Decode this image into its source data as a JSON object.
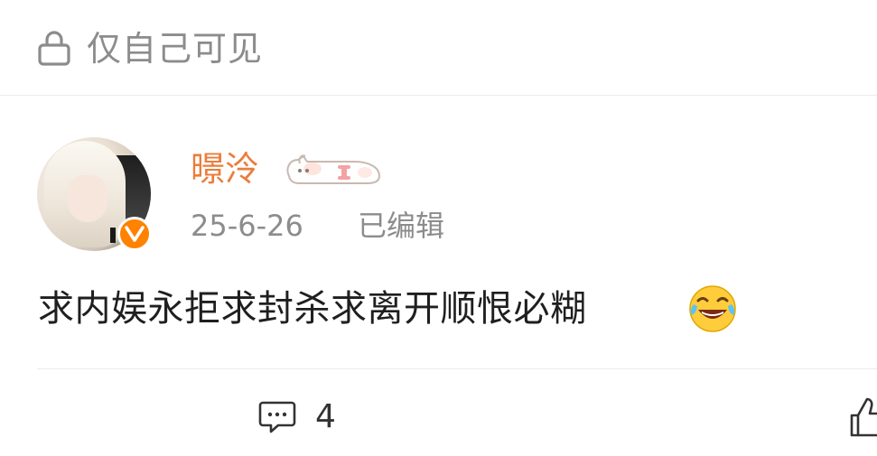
{
  "visibility": {
    "icon": "lock-icon",
    "label": "仅自己可见"
  },
  "comment": {
    "avatar": {
      "icon": "avatar",
      "verified_badge_letter": "V",
      "verified_color": "#ff8200"
    },
    "username": "暻泠",
    "username_color": "#eb7d3c",
    "badge_icon": "cat-fan-badge-icon",
    "timestamp": "25-6-26",
    "edited_label": "已编辑",
    "text": "求内娱永拒求封杀求离开顺恨必糊",
    "emoji": "laughing-tears-emoji"
  },
  "actions": {
    "comment_icon": "comment-icon",
    "comment_count": "4",
    "like_icon": "like-icon"
  }
}
